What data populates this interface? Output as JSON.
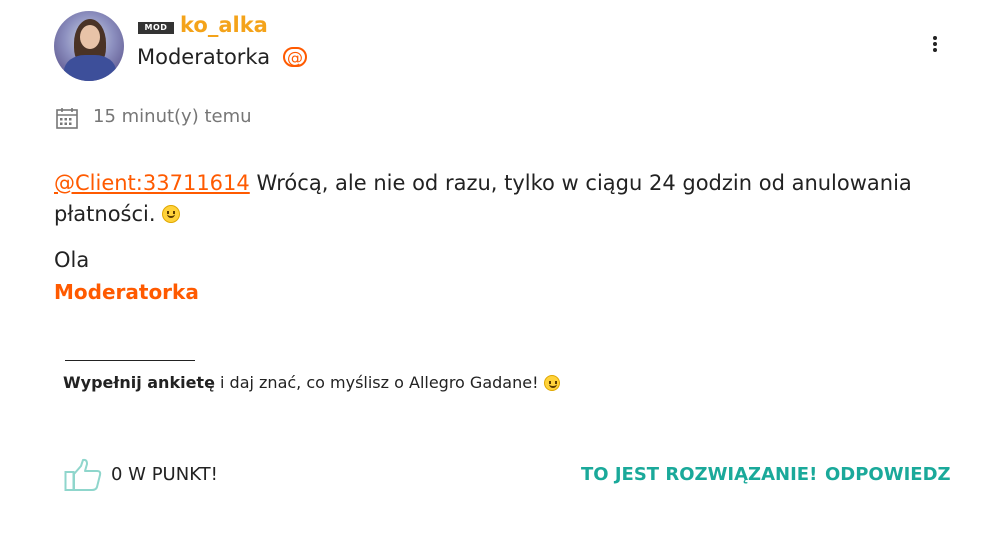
{
  "author": {
    "badge": "MOD",
    "username": "ko_alka",
    "role": "Moderatorka"
  },
  "post": {
    "time": "15 minut(y) temu",
    "mention": "@Client:33711614",
    "text": " Wrócą, ale nie od razu, tylko w ciągu 24 godzin od anulowania płatności. ",
    "signature_name": "Ola",
    "signature_role": "Moderatorka"
  },
  "footer_note": {
    "link_text": "Wypełnij ankietę",
    "rest": " i daj znać, co myślisz o Allegro Gadane! "
  },
  "actions": {
    "likes": "0 W PUNKT!",
    "solution": "TO JEST ROZWIĄZANIE!",
    "reply": "ODPOWIEDZ"
  },
  "colors": {
    "accent": "#ff5a00",
    "username": "#f4a31a",
    "action": "#1aa99a"
  },
  "icons": [
    "kebab-menu-icon",
    "mention-icon",
    "calendar-icon",
    "smiley-icon",
    "thumbs-up-icon"
  ]
}
